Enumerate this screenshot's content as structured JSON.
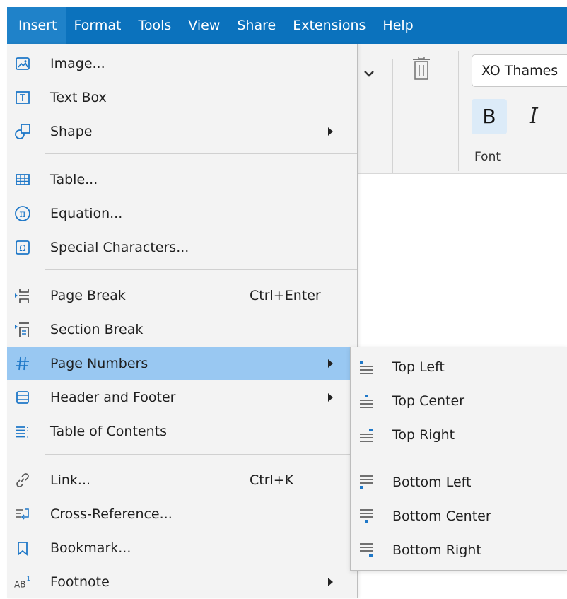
{
  "menubar": {
    "items": [
      "Insert",
      "Format",
      "Tools",
      "View",
      "Share",
      "Extensions",
      "Help"
    ]
  },
  "toolbar": {
    "font_name": "XO Thames",
    "bold_label": "B",
    "italic_label": "I",
    "group_label": "Font"
  },
  "insert_menu": {
    "items": [
      {
        "label": "Image...",
        "icon": "image-icon"
      },
      {
        "label": "Text Box",
        "icon": "text-box-icon"
      },
      {
        "label": "Shape",
        "icon": "shape-icon",
        "submenu": true
      },
      {
        "label": "Table...",
        "icon": "table-icon"
      },
      {
        "label": "Equation...",
        "icon": "equation-icon"
      },
      {
        "label": "Special Characters...",
        "icon": "special-characters-icon"
      },
      {
        "label": "Page Break",
        "icon": "page-break-icon",
        "shortcut": "Ctrl+Enter"
      },
      {
        "label": "Section Break",
        "icon": "section-break-icon"
      },
      {
        "label": "Page Numbers",
        "icon": "hash-icon",
        "submenu": true,
        "highlighted": true
      },
      {
        "label": "Header and Footer",
        "icon": "header-footer-icon",
        "submenu": true
      },
      {
        "label": "Table of Contents",
        "icon": "table-of-contents-icon"
      },
      {
        "label": "Link...",
        "icon": "link-icon",
        "shortcut": "Ctrl+K"
      },
      {
        "label": "Cross-Reference...",
        "icon": "cross-reference-icon"
      },
      {
        "label": "Bookmark...",
        "icon": "bookmark-icon"
      },
      {
        "label": "Footnote",
        "icon": "footnote-icon",
        "submenu": true
      }
    ]
  },
  "page_numbers_submenu": {
    "items": [
      {
        "label": "Top Left",
        "icon": "top-left-icon"
      },
      {
        "label": "Top Center",
        "icon": "top-center-icon"
      },
      {
        "label": "Top Right",
        "icon": "top-right-icon"
      },
      {
        "label": "Bottom Left",
        "icon": "bottom-left-icon"
      },
      {
        "label": "Bottom Center",
        "icon": "bottom-center-icon"
      },
      {
        "label": "Bottom Right",
        "icon": "bottom-right-icon"
      }
    ]
  },
  "colors": {
    "menubar_bg": "#0b72bd",
    "highlight_bg": "#99c8f2",
    "icon_blue": "#1f78c8",
    "menu_bg": "#f3f3f3"
  }
}
